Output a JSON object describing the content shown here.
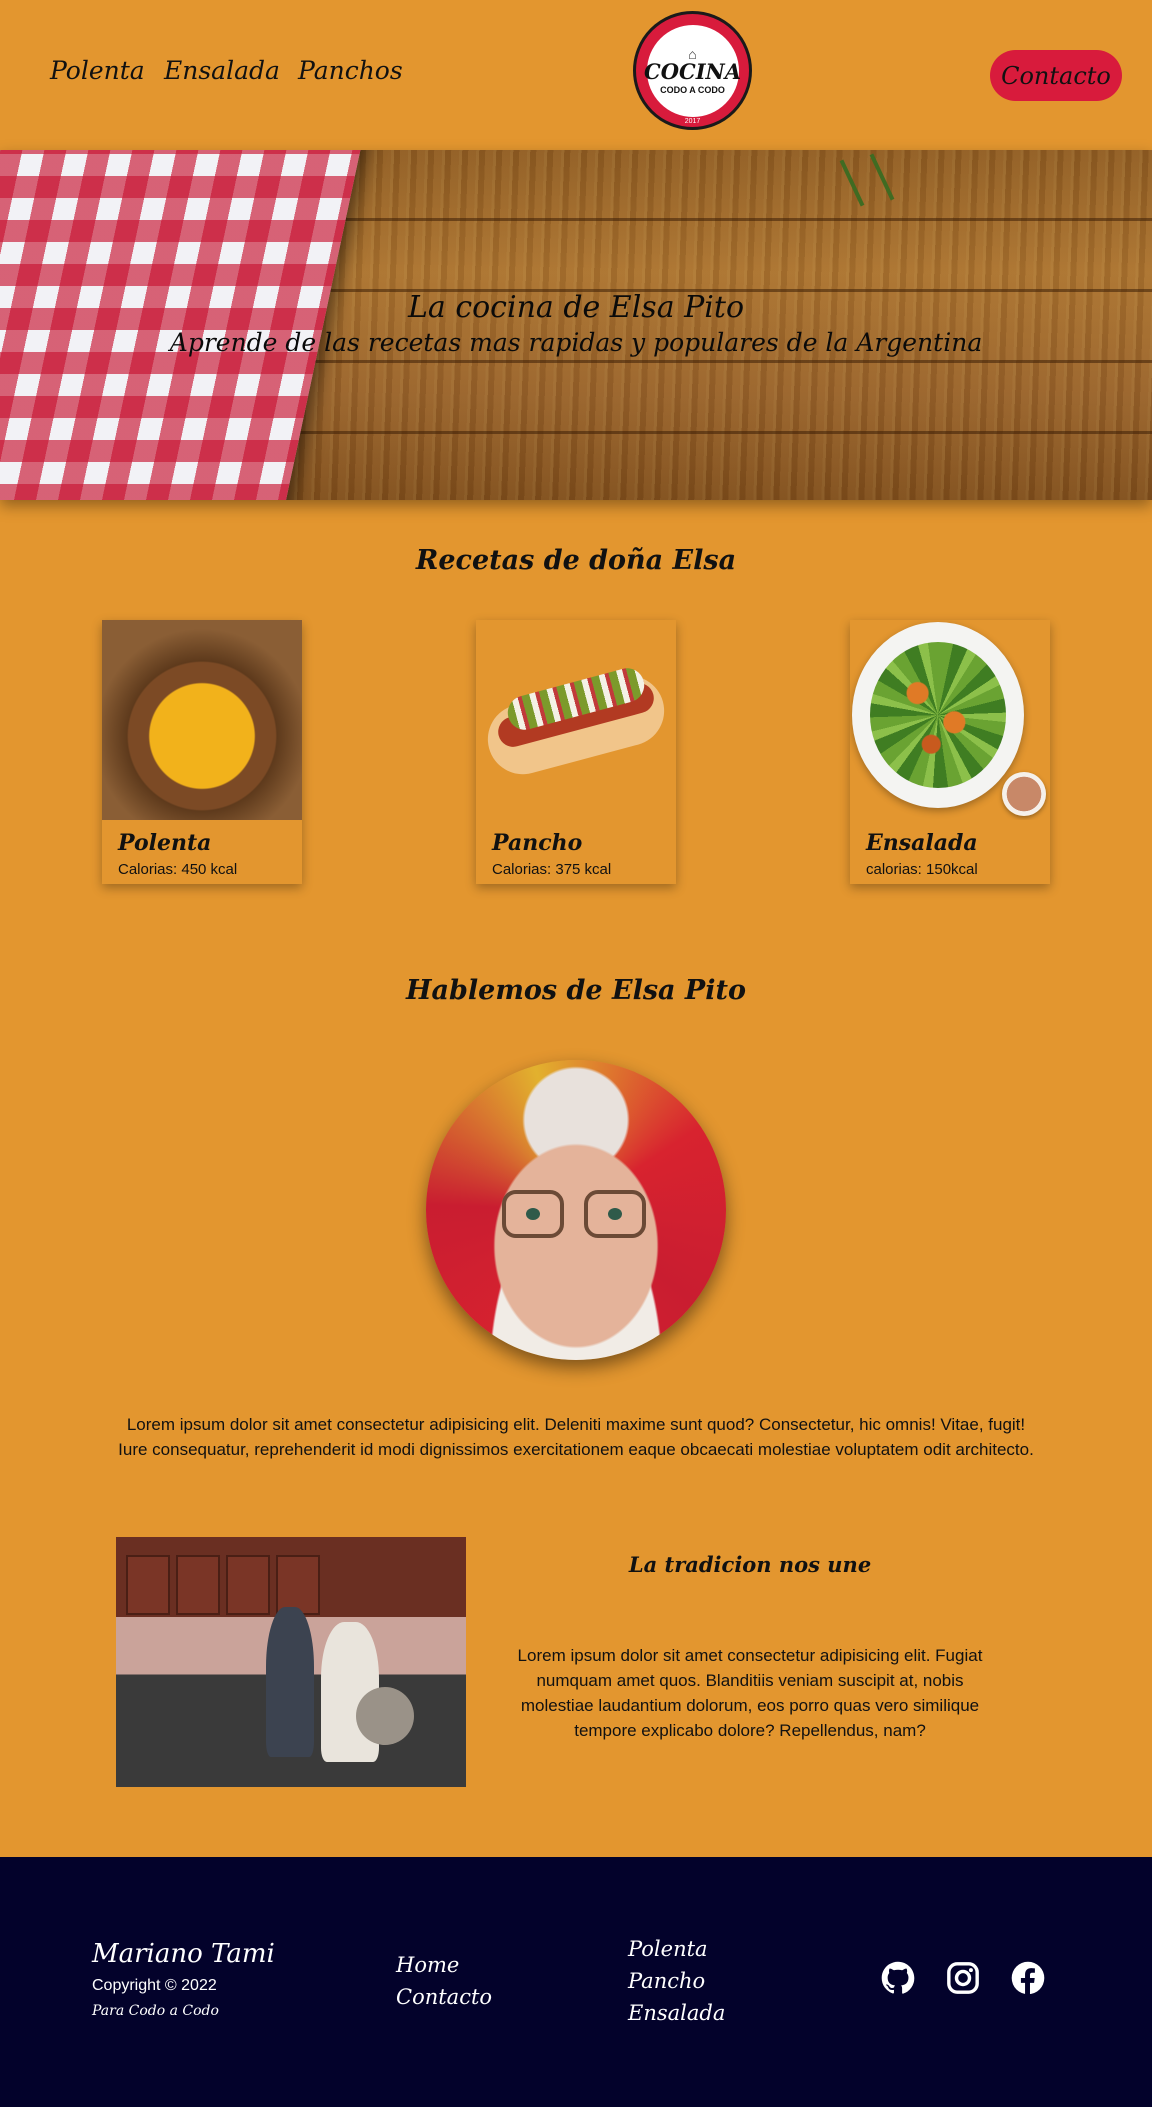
{
  "header": {
    "nav": [
      "Polenta",
      "Ensalada",
      "Panchos"
    ],
    "logo": {
      "word": "COCINA",
      "hat": "⌂",
      "sub": "CODO A CODO",
      "year": "2017"
    },
    "contact_label": "Contacto"
  },
  "hero": {
    "title": "La cocina de Elsa Pito",
    "subtitle": "Aprende de las recetas mas rapidas y populares de la Argentina"
  },
  "recipes": {
    "title": "Recetas de doña Elsa",
    "cards": [
      {
        "name": "Polenta",
        "calories": "Calorias: 450 kcal"
      },
      {
        "name": "Pancho",
        "calories": "Calorias: 375 kcal"
      },
      {
        "name": "Ensalada",
        "calories": "calorias: 150kcal"
      }
    ]
  },
  "about": {
    "title": "Hablemos de Elsa Pito",
    "paragraph": "Lorem ipsum dolor sit amet consectetur adipisicing elit. Deleniti maxime sunt quod? Consectetur, hic omnis! Vitae, fugit! Iure consequatur, reprehenderit id modi dignissimos exercitationem eaque obcaecati molestiae voluptatem odit architecto.",
    "tradition_title": "La tradicion nos une",
    "tradition_text": "Lorem ipsum dolor sit amet consectetur adipisicing elit. Fugiat numquam amet quos. Blanditiis veniam suscipit at, nobis molestiae laudantium dolorum, eos porro quas vero similique tempore explicabo dolore? Repellendus, nam?"
  },
  "footer": {
    "name": "Mariano Tami",
    "copyright": "Copyright © 2022",
    "for": "Para Codo a Codo",
    "links_a": [
      "Home",
      "Contacto"
    ],
    "links_b": [
      "Polenta",
      "Pancho",
      "Ensalada"
    ],
    "social": [
      "github-icon",
      "instagram-icon",
      "facebook-icon"
    ]
  },
  "colors": {
    "background": "#e3962f",
    "accent": "#d81b3c",
    "footer": "#03022b"
  }
}
